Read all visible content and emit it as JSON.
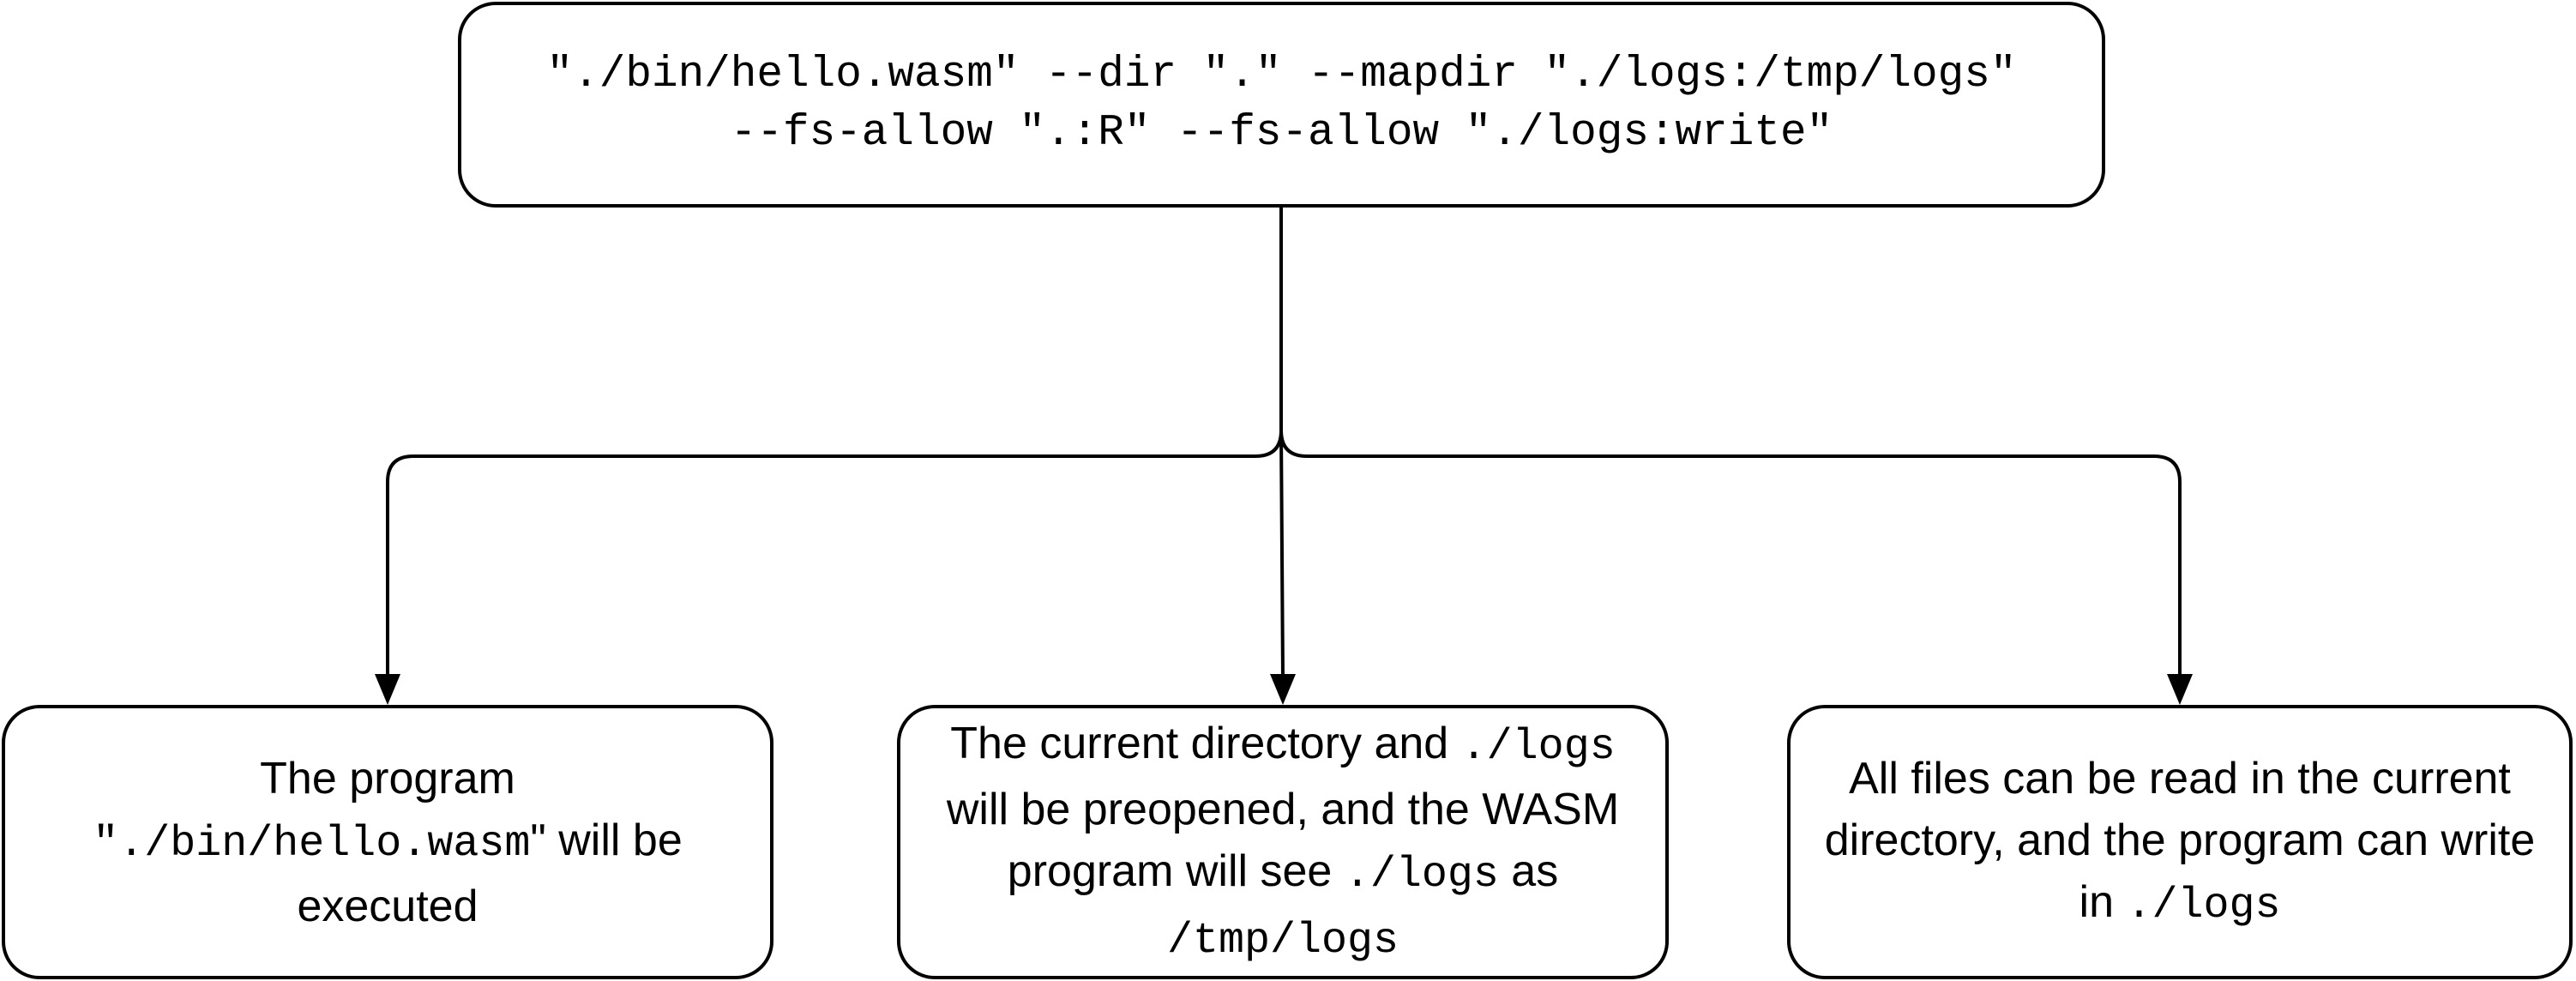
{
  "command": {
    "line1": "\"./bin/hello.wasm\" --dir \".\" --mapdir \"./logs:/tmp/logs\"",
    "line2": "--fs-allow \".:R\" --fs-allow \"./logs:write\""
  },
  "nodes": {
    "left": {
      "t1": "The program",
      "c1": "\"./bin/hello.wasm",
      "t2": "\" will be",
      "t3": "executed"
    },
    "middle": {
      "t1": "The current directory and ",
      "c1": "./logs",
      "t2": "will be preopened, and the WASM",
      "t3": "program will see ",
      "c2": "./logs",
      "t4": " as",
      "c3": "/tmp/logs"
    },
    "right": {
      "t1": "All files can be read in the current",
      "t2": "directory, and the program can write",
      "t3": "in ",
      "c1": "./logs"
    }
  }
}
